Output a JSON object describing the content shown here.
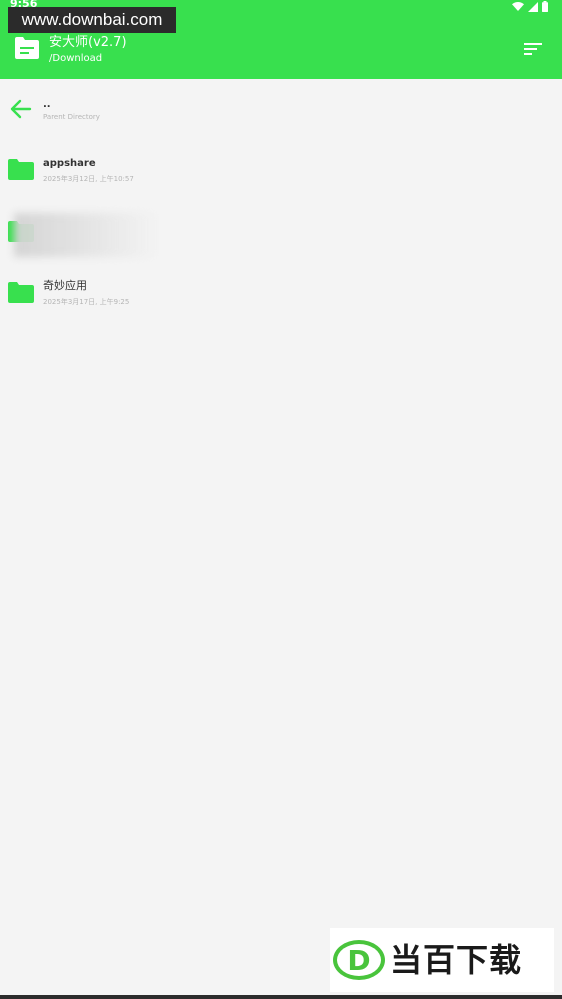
{
  "status": {
    "time": "9:56"
  },
  "watermark": {
    "text": "www.downbai.com"
  },
  "app": {
    "title": "安大师(v2.7)",
    "path": "/Download"
  },
  "list": {
    "parent": {
      "name": "..",
      "meta": "Parent Directory"
    },
    "items": [
      {
        "name": "appshare",
        "meta": "2025年3月12日, 上午10:57"
      },
      {
        "name": "奇妙应用",
        "meta": "2025年3月17日, 上午9:25"
      }
    ]
  },
  "logo": {
    "letter": "D",
    "text": "当百下载"
  },
  "colors": {
    "accent": "#38e04e",
    "background": "#f4f4f4"
  },
  "icons": {
    "app": "folder-document-icon",
    "sort": "sort-icon",
    "back": "arrow-left-icon",
    "folder": "folder-icon"
  }
}
